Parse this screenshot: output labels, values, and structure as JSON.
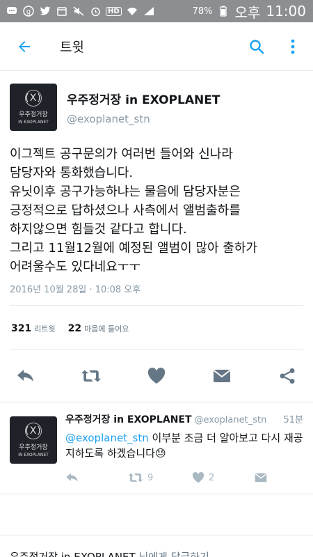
{
  "status_bar": {
    "battery": "78%",
    "ampm": "오후",
    "time": "11:00",
    "hd_label": "HD"
  },
  "appbar": {
    "title": "트윗"
  },
  "tweet": {
    "display_name": "우주정거장 in EXOPLANET",
    "handle": "@exoplanet_stn",
    "avatar_logo": "(X)",
    "avatar_line1": "우주정거장",
    "avatar_line2": "IN EXOPLANET",
    "text": "이그젝트 공구문의가 여러번 들어와 신나라\n담당자와 통화했습니다.\n유닛이후 공구가능하냐는 물음에 담당자분은\n긍정적으로 답하셨으나 사측에서 앨범출하를\n하지않으면 힘들것 같다고 합니다.\n그리고 11월12월에 예정된 앨범이 많아 출하가\n어려울수도 있다네요ㅜㅜ",
    "timestamp": "2016년 10월 28일 · 10:08 오후",
    "retweets_count": "321",
    "retweets_label": "리트윗",
    "likes_count": "22",
    "likes_label": "마음에 들어요"
  },
  "reply": {
    "display_name": "우주정거장 in EXOPLANET",
    "handle": "@exoplanet_stn",
    "time_ago": "51분",
    "mention": "@exoplanet_stn",
    "text": " 이부분 조금 더 알아보고 다시 재공지하도록 하겠습니다😓",
    "retweet_count": "9",
    "like_count": "2"
  },
  "compose": {
    "name": "우주정거장 in EXOPLANET",
    "suffix": " 님에게 답글하기"
  },
  "colors": {
    "accent": "#1da1f2",
    "status_bar": "#8c8f92",
    "muted": "#8899a6"
  }
}
